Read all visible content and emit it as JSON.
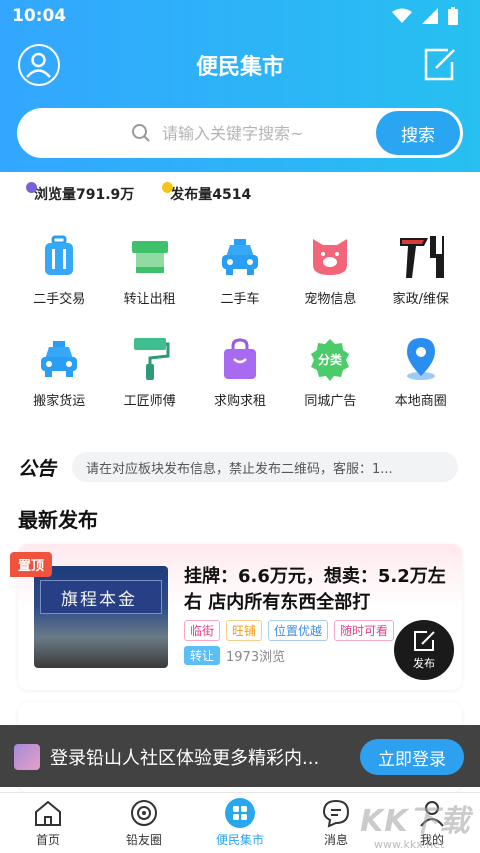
{
  "status": {
    "time": "10:04"
  },
  "header": {
    "title": "便民集市"
  },
  "search": {
    "placeholder": "请输入关键字搜索~",
    "button": "搜索"
  },
  "stats": {
    "views": {
      "label": "浏览量791.9万",
      "dot_color": "#7b61d8"
    },
    "posts": {
      "label": "发布量4514",
      "dot_color": "#f5c518"
    }
  },
  "categories": [
    {
      "label": "二手交易",
      "icon": "luggage-icon"
    },
    {
      "label": "转让出租",
      "icon": "shop-stall-icon"
    },
    {
      "label": "二手车",
      "icon": "car-icon"
    },
    {
      "label": "宠物信息",
      "icon": "pig-icon"
    },
    {
      "label": "家政/维保",
      "icon": "tools-icon"
    },
    {
      "label": "搬家货运",
      "icon": "van-icon"
    },
    {
      "label": "工匠师傅",
      "icon": "paint-roller-icon"
    },
    {
      "label": "求购求租",
      "icon": "shopping-bag-icon"
    },
    {
      "label": "同城广告",
      "icon": "ad-badge-icon"
    },
    {
      "label": "本地商圈",
      "icon": "location-pin-icon"
    }
  ],
  "notice": {
    "tag": "公告",
    "text": "请在对应板块发布信息，禁止发布二维码，客服：1..."
  },
  "latest": {
    "title": "最新发布"
  },
  "listing": {
    "badge": "置顶",
    "title": "挂牌：6.6万元，想卖：5.2万左右 店内所有东西全部打",
    "tags": [
      {
        "label": "临街",
        "color": "#e83e8c"
      },
      {
        "label": "旺铺",
        "color": "#f39c12"
      },
      {
        "label": "位置优越",
        "color": "#3a8ee6"
      },
      {
        "label": "随时可看",
        "color": "#e83e8c"
      }
    ],
    "category": "转让",
    "views": "1973浏览",
    "thumb_sign": "旗程本金"
  },
  "fab": {
    "label": "发布"
  },
  "login_banner": {
    "text": "登录铅山人社区体验更多精彩内...",
    "button": "立即登录"
  },
  "tabs": [
    {
      "label": "首页",
      "icon": "home-icon",
      "active": false
    },
    {
      "label": "铅友圈",
      "icon": "circle-icon",
      "active": false
    },
    {
      "label": "便民集市",
      "icon": "market-icon",
      "active": true
    },
    {
      "label": "消息",
      "icon": "message-icon",
      "active": false
    },
    {
      "label": "我的",
      "icon": "profile-icon",
      "active": false
    }
  ],
  "watermark": {
    "text": "KK下载",
    "sub": "www.kkx.net"
  },
  "colors": {
    "brand": "#2aa5f2",
    "pin": "#f0533d"
  }
}
